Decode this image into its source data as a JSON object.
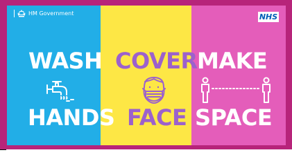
{
  "header": {
    "gov_text": "HM Government",
    "nhs_text": "NHS"
  },
  "panels": {
    "wash": {
      "top_word": "WASH",
      "bottom_word": "HANDS",
      "icon": "tap-icon",
      "color": "#22aee7"
    },
    "cover": {
      "top_word": "COVER",
      "bottom_word": "FACE",
      "icon": "mask-face-icon",
      "color": "#fde745"
    },
    "make": {
      "top_word": "MAKE",
      "bottom_word": "SPACE",
      "icon": "distance-icon",
      "color": "#e45dba"
    }
  },
  "colors": {
    "border": "#b7247a",
    "text_white": "#ffffff",
    "text_purple": "#9c61cc",
    "nhs_blue": "#005eb8"
  }
}
